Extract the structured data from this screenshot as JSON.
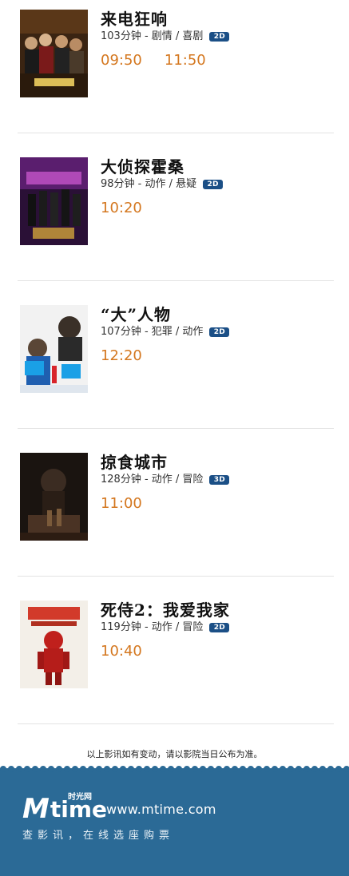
{
  "movies": [
    {
      "title": "来电狂响",
      "meta": "103分钟 - 剧情 / 喜剧",
      "format": "2D",
      "times": [
        "09:50",
        "11:50"
      ]
    },
    {
      "title": "大侦探霍桑",
      "meta": "98分钟 - 动作 / 悬疑",
      "format": "2D",
      "times": [
        "10:20"
      ]
    },
    {
      "title": "“大”人物",
      "meta": "107分钟 - 犯罪 / 动作",
      "format": "2D",
      "times": [
        "12:20"
      ]
    },
    {
      "title": "掠食城市",
      "meta": "128分钟 - 动作 / 冒险",
      "format": "3D",
      "times": [
        "11:00"
      ]
    },
    {
      "title": "死侍2：我爱我家",
      "meta": "119分钟 - 动作 / 冒险",
      "format": "2D",
      "times": [
        "10:40"
      ]
    }
  ],
  "notice": "以上影讯如有变动，请以影院当日公布为准。",
  "footer": {
    "logo_m": "M",
    "logo_time": "time",
    "logo_cn": "时光网",
    "site": "www.mtime.com",
    "slogan": "查影讯，在线选座购票"
  },
  "colors": {
    "time": "#d4771f",
    "badge": "#1b4f86",
    "footer": "#2b6a96"
  }
}
